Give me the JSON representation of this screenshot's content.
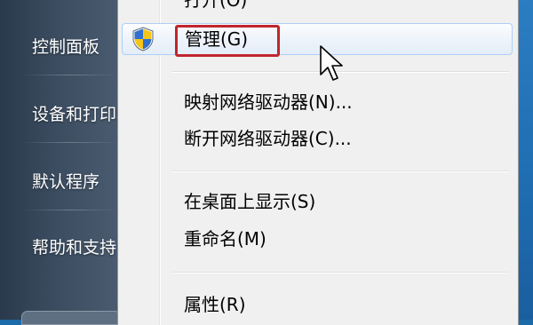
{
  "left_pane": {
    "items": [
      {
        "label": "控制面板"
      },
      {
        "label": "设备和打印机"
      },
      {
        "label": "默认程序"
      },
      {
        "label": "帮助和支持"
      }
    ]
  },
  "context_menu": {
    "items": [
      {
        "label": "打开(O)",
        "icon": "",
        "highlighted": false
      },
      {
        "label": "管理(G)",
        "icon": "uac-shield-icon",
        "highlighted": true,
        "annotated": true
      },
      {
        "label": "映射网络驱动器(N)...",
        "icon": "",
        "highlighted": false
      },
      {
        "label": "断开网络驱动器(C)...",
        "icon": "",
        "highlighted": false
      },
      {
        "label": "在桌面上显示(S)",
        "icon": "",
        "highlighted": false
      },
      {
        "label": "重命名(M)",
        "icon": "",
        "highlighted": false
      },
      {
        "label": "属性(R)",
        "icon": "",
        "highlighted": false
      }
    ]
  },
  "colors": {
    "annotation_border": "#c0262d",
    "highlight_border": "#aecff7",
    "menu_background": "#f0f0f0"
  }
}
